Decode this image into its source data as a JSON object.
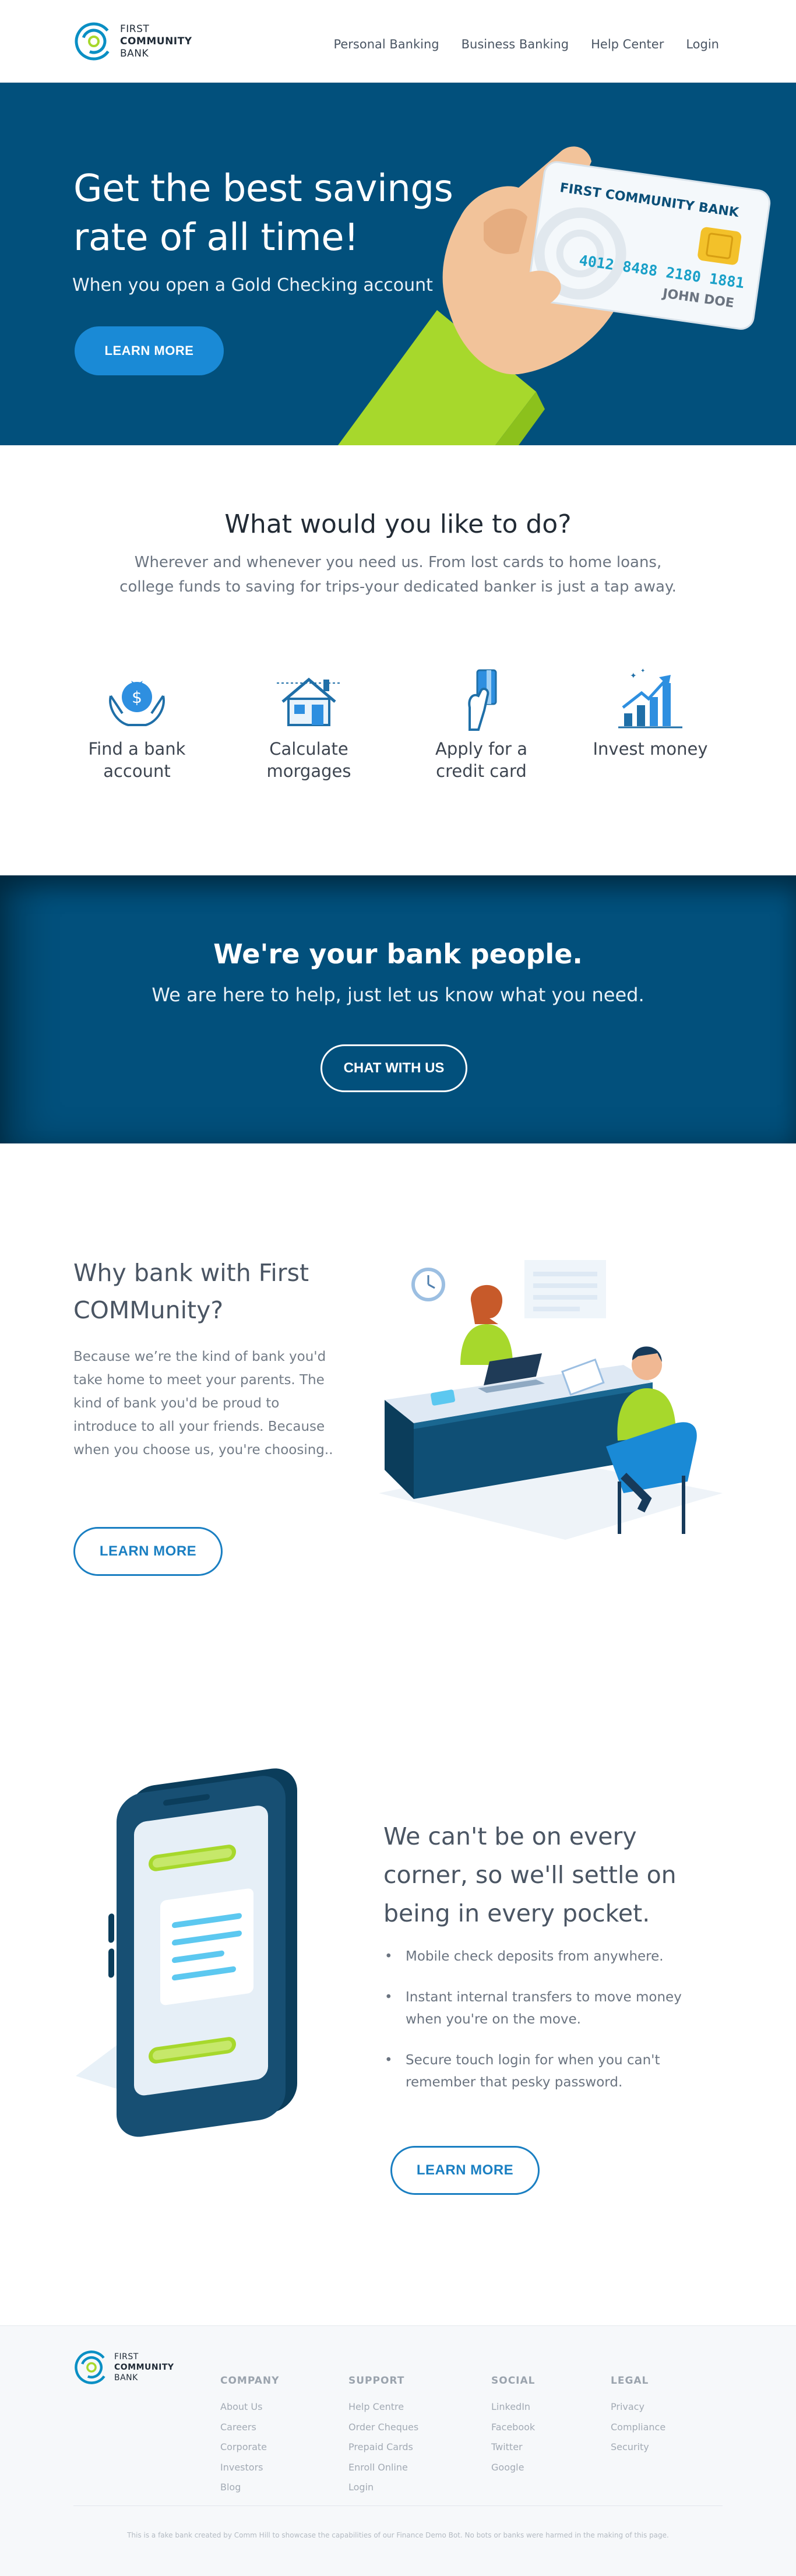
{
  "brand": {
    "line1": "FIRST",
    "line2": "COMMUNITY",
    "line3": "BANK",
    "colors": {
      "navy": "#02507c",
      "blue": "#1a8ad6",
      "lime": "#a7d82c"
    }
  },
  "nav": {
    "items": [
      {
        "label": "Personal Banking"
      },
      {
        "label": "Business Banking"
      },
      {
        "label": "Help Center"
      },
      {
        "label": "Login"
      }
    ]
  },
  "hero": {
    "title": "Get the best savings rate of all time!",
    "subtitle": "When you open a Gold Checking account",
    "cta": "LEARN MORE",
    "card": {
      "bank": "FIRST COMMUNITY BANK",
      "number": "4012 8488 2180 1881",
      "holder": "JOHN DOE"
    }
  },
  "options": {
    "title": "What would you like to do?",
    "lead": "Wherever and whenever you need us. From lost cards to home loans, college funds to saving for trips-your dedicated banker is just a tap away.",
    "items": [
      {
        "label": "Find a bank account",
        "icon": "money-bag-hands-icon"
      },
      {
        "label": "Calculate morgages",
        "icon": "house-icon"
      },
      {
        "label": "Apply for a credit card",
        "icon": "hand-card-icon"
      },
      {
        "label": "Invest money",
        "icon": "growth-chart-icon"
      }
    ]
  },
  "people": {
    "title": "We're your bank people.",
    "subtitle": "We are here to help, just let us know what you need.",
    "cta": "CHAT WITH US"
  },
  "why": {
    "title": "Why bank with First COMMunity?",
    "body": "Because we’re the kind of bank you'd take home to meet your parents. The kind of bank you'd be proud to introduce to all your friends. Because when you choose us, you're choosing..",
    "cta": "LEARN MORE"
  },
  "pocket": {
    "title": "We can't be on every corner, so we'll settle on being in every pocket.",
    "bullets": [
      "Mobile check deposits from anywhere.",
      "Instant internal transfers to move money when you're on the move.",
      "Secure touch login for when you can't remember that pesky password."
    ],
    "cta": "LEARN MORE"
  },
  "footer": {
    "columns": [
      {
        "heading": "COMPANY",
        "links": [
          "About Us",
          "Careers",
          "Corporate",
          "Investors",
          "Blog"
        ]
      },
      {
        "heading": "SUPPORT",
        "links": [
          "Help Centre",
          "Order Cheques",
          "Prepaid Cards",
          "Enroll Online",
          "Login"
        ]
      },
      {
        "heading": "SOCIAL",
        "links": [
          "LinkedIn",
          "Facebook",
          "Twitter",
          "Google"
        ]
      },
      {
        "heading": "LEGAL",
        "links": [
          "Privacy",
          "Compliance",
          "Security"
        ]
      }
    ],
    "note": "This is a fake bank created by Comm Hill to showcase the capabilities of our Finance Demo Bot. No bots or banks were harmed in the making of this page."
  }
}
